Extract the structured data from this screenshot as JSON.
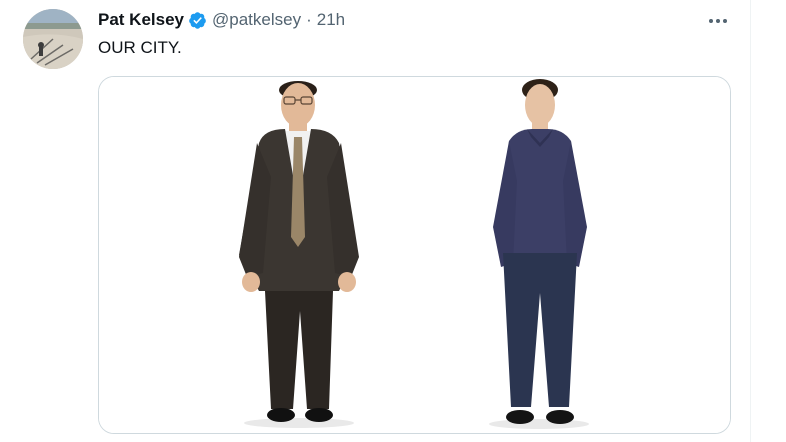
{
  "tweet": {
    "author_name": "Pat Kelsey",
    "handle": "@patkelsey",
    "separator": "·",
    "timestamp": "21h",
    "text": "OUR CITY."
  },
  "icons": {
    "verified": "verified-badge-icon",
    "more": "more-options-icon"
  },
  "colors": {
    "verified_blue": "#1d9bf0",
    "text_primary": "#0f1419",
    "text_secondary": "#536471"
  }
}
